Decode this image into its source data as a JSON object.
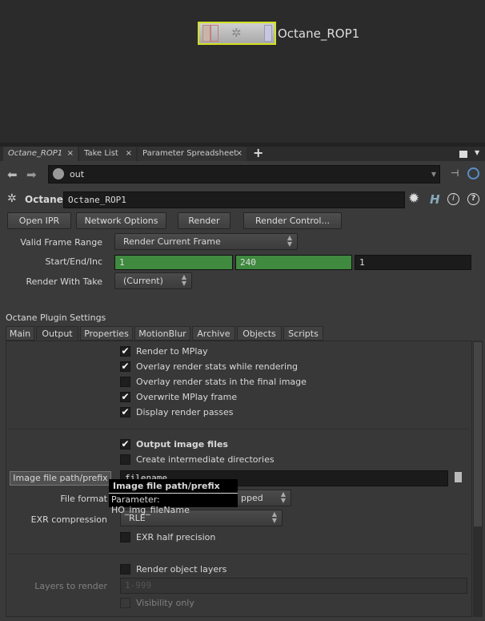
{
  "network": {
    "node_name": "Octane_ROP1"
  },
  "tabs": [
    {
      "label": "Octane_ROP1"
    },
    {
      "label": "Take List"
    },
    {
      "label": "Parameter Spreadsheet"
    }
  ],
  "tab_close": "×",
  "tab_add": "+",
  "path": {
    "value": "out"
  },
  "header": {
    "type": "Octane",
    "name": "Octane_ROP1"
  },
  "buttons": {
    "open_ipr": "Open IPR",
    "network_options": "Network Options",
    "render": "Render",
    "render_control": "Render Control..."
  },
  "params": {
    "valid_frame_range": {
      "label": "Valid Frame Range",
      "value": "Render Current Frame"
    },
    "start_end_inc": {
      "label": "Start/End/Inc",
      "start": "1",
      "end": "240",
      "inc": "1"
    },
    "render_with_take": {
      "label": "Render With Take",
      "value": "(Current)"
    }
  },
  "section_title": "Octane Plugin Settings",
  "param_tabs": [
    "Main",
    "Output",
    "Properties",
    "MotionBlur",
    "Archive",
    "Objects",
    "Scripts"
  ],
  "output": {
    "mplay": [
      {
        "label": "Render to MPlay",
        "checked": true
      },
      {
        "label": "Overlay render stats while rendering",
        "checked": true
      },
      {
        "label": "Overlay render stats in the final image",
        "checked": false
      },
      {
        "label": "Overwrite MPlay frame",
        "checked": true
      },
      {
        "label": "Display render passes",
        "checked": true
      }
    ],
    "output_image_files": {
      "label": "Output image files",
      "checked": true
    },
    "create_dirs": {
      "label": "Create intermediate directories",
      "checked": false
    },
    "image_path": {
      "label": "Image file path/prefix",
      "value": "filename"
    },
    "file_format": {
      "label": "File format",
      "value": "pped"
    },
    "exr_compression": {
      "label": "EXR compression",
      "value": "RLE"
    },
    "exr_half": {
      "label": "EXR half precision",
      "checked": false
    },
    "render_object_layers": {
      "label": "Render object layers",
      "checked": false
    },
    "layers_to_render": {
      "label": "Layers to render",
      "placeholder": "1-999"
    },
    "visibility_only": {
      "label": "Visibility only",
      "checked": false
    }
  },
  "tooltip": {
    "title": "Image file path/prefix",
    "body": "Parameter: HO_img_fileName"
  },
  "check_glyph": "✔"
}
